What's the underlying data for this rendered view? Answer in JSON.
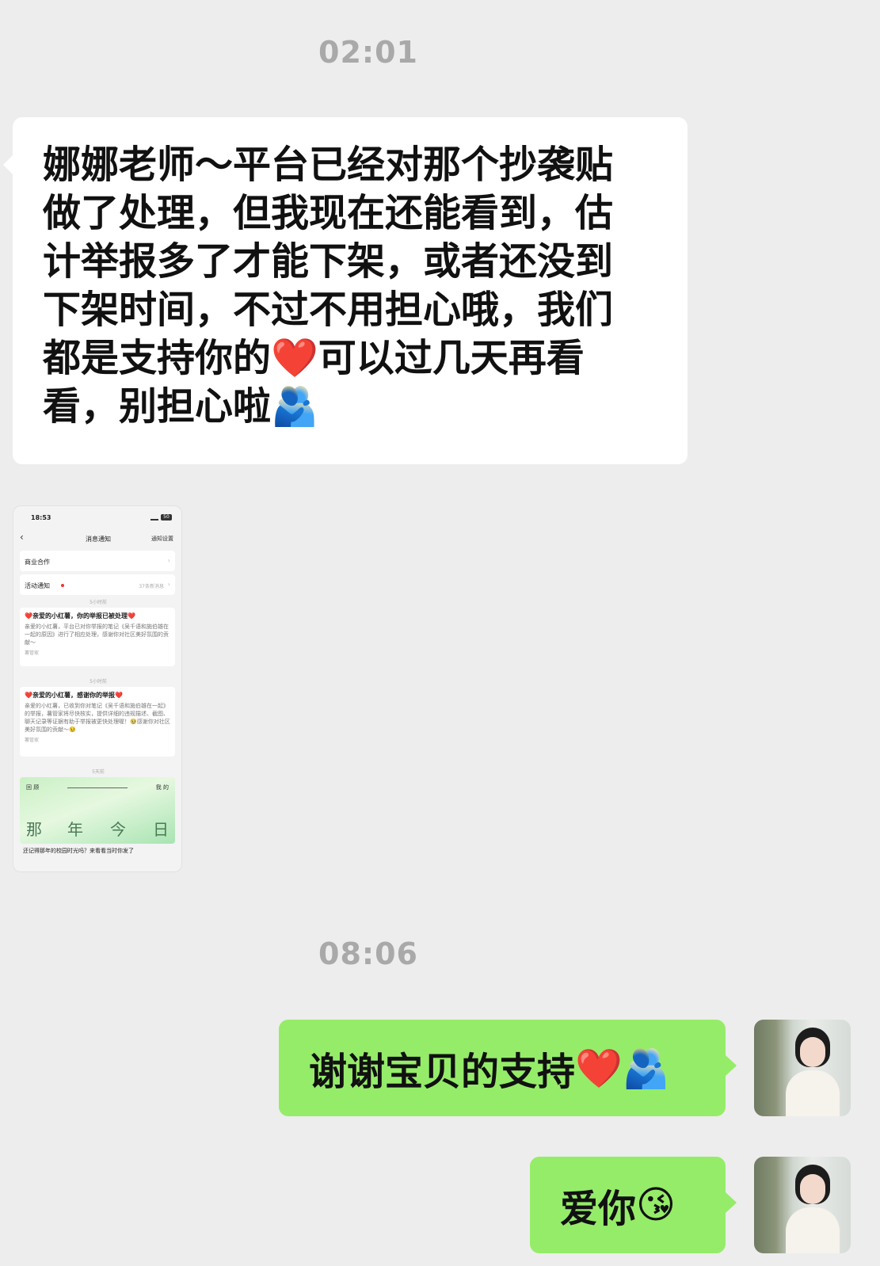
{
  "timestamps": {
    "first": "02:01",
    "second": "08:06"
  },
  "incoming_message": {
    "lines": [
      "娜娜老师～平台已经对那个抄袭贴",
      "做了处理，但我现在还能看到，估",
      "计举报多了才能下架，或者还没到",
      "下架时间，不过不用担心哦，我们"
    ],
    "line5_before": "都是支持你的",
    "line5_emoji": "❤️",
    "line5_after": "可以过几天再看",
    "line6_text": "看，别担心啦",
    "line6_emoji": "🫂"
  },
  "screenshot": {
    "status_time": "18:53",
    "status_battery": "50",
    "back_icon": "chevron-left-icon",
    "title": "消息通知",
    "settings": "通知设置",
    "row1_label": "商业合作",
    "row2_label": "活动通知",
    "row2_meta": "37条新消息",
    "time1": "5小时前",
    "card1_title": "❤️亲爱的小红薯，你的举报已被处理❤️",
    "card1_body": "亲爱的小红薯，平台已对你举报的笔记《吴千语和施伯雄在一起的原因》进行了相应处理，感谢你对社区美好氛围的贡献～",
    "card1_sender": "薯管家",
    "time2": "5小时前",
    "card2_title": "❤️亲爱的小红薯，感谢你的举报❤️",
    "card2_body": "亲爱的小红薯，已收到你对笔记《吴千语和施伯雄在一起》的举报，薯管家将尽快核实，提供详细的违规描述、截图、聊天记录等证据有助于举报被更快处理喔！🥹感谢你对社区美好氛围的贡献～🥹",
    "card2_sender": "薯管家",
    "time3": "5天前",
    "banner_top_left": "回  顾",
    "banner_top_right": "我  的",
    "banner_chars": [
      "那",
      "年",
      "今",
      "日"
    ],
    "bottom_text": "还记得那年的校园时光吗？来看看当时你发了"
  },
  "outgoing_messages": [
    {
      "text": "谢谢宝贝的支持",
      "emojis": "❤️🫂"
    },
    {
      "text": "爱你",
      "emojis": "😘"
    }
  ],
  "colors": {
    "background": "#ededed",
    "incoming_bubble": "#ffffff",
    "outgoing_bubble": "#95ec69",
    "timestamp": "#a9a9a9"
  }
}
